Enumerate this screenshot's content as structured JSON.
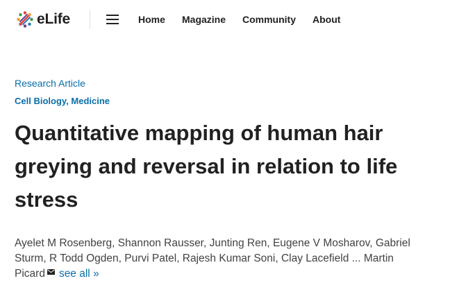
{
  "header": {
    "logo_text": "eLife",
    "nav": [
      "Home",
      "Magazine",
      "Community",
      "About"
    ]
  },
  "article": {
    "type": "Research Article",
    "subjects": [
      "Cell Biology",
      "Medicine"
    ],
    "subject_separator": ", ",
    "title": "Quantitative mapping of human hair greying and reversal in relation to life stress",
    "authors_line1": "Ayelet M Rosenberg, Shannon Rausser, Junting Ren, Eugene V Mosharov, Gabriel",
    "authors_line2": "Sturm, R Todd Ogden, Purvi Patel, Rajesh Kumar Soni, Clay Lacefield ... Martin",
    "authors_line3": "Picard",
    "see_all": "see all",
    "see_all_chevron": "»"
  },
  "colors": {
    "link": "#0a6ea8",
    "text": "#212121",
    "logo_red": "#e4413b",
    "logo_purple": "#6a3f95",
    "logo_blue": "#2a7ab8",
    "logo_green": "#3c9a4a",
    "logo_orange": "#f29d28"
  },
  "icons": {
    "logo": "elife-logo-icon",
    "menu": "hamburger-menu-icon",
    "corresponding": "envelope-icon"
  }
}
